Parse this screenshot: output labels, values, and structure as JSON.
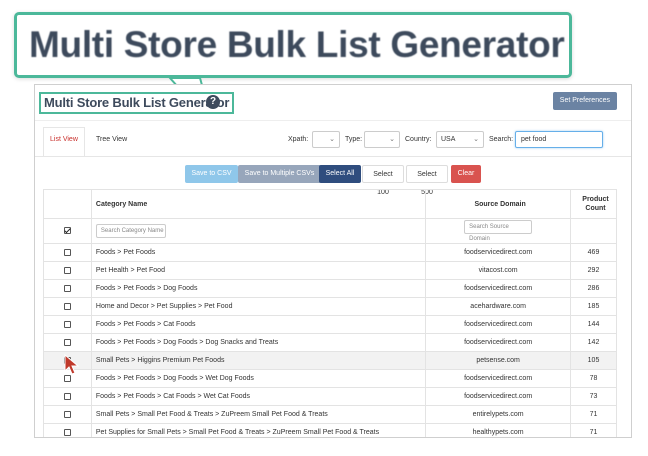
{
  "callout": {
    "title": "Multi Store Bulk List Generator"
  },
  "header": {
    "title": "Multi Store Bulk List Generator",
    "help_glyph": "?",
    "preferences_label": "Set Preferences"
  },
  "toolbar": {
    "tabs": [
      {
        "label": "List View",
        "active": true
      },
      {
        "label": "Tree View",
        "active": false
      }
    ],
    "xpath_label": "Xpath:",
    "xpath_value": "",
    "type_label": "Type:",
    "type_value": "",
    "country_label": "Country:",
    "country_value": "USA",
    "search_label": "Search:",
    "search_value": "pet food"
  },
  "actions": {
    "save_csv": "Save to CSV",
    "save_multi": "Save to Multiple CSVs",
    "select_all": "Select All",
    "select_100": "Select 100",
    "select_500": "Select 500",
    "clear": "Clear"
  },
  "table": {
    "columns": {
      "category": "Category Name",
      "domain": "Source Domain",
      "count_line1": "Product",
      "count_line2": "Count"
    },
    "filters": {
      "category_placeholder": "Search Category Name",
      "domain_placeholder": "Search Source Domain"
    },
    "rows": [
      {
        "category": "Foods > Pet Foods",
        "domain": "foodservicedirect.com",
        "count": "469"
      },
      {
        "category": "Pet Health > Pet Food",
        "domain": "vitacost.com",
        "count": "292"
      },
      {
        "category": "Foods > Pet Foods > Dog Foods",
        "domain": "foodservicedirect.com",
        "count": "286"
      },
      {
        "category": "Home and Decor > Pet Supplies > Pet Food",
        "domain": "acehardware.com",
        "count": "185"
      },
      {
        "category": "Foods > Pet Foods > Cat Foods",
        "domain": "foodservicedirect.com",
        "count": "144"
      },
      {
        "category": "Foods > Pet Foods > Dog Foods > Dog Snacks and Treats",
        "domain": "foodservicedirect.com",
        "count": "142"
      },
      {
        "category": "Small Pets > Higgins Premium Pet Foods",
        "domain": "petsense.com",
        "count": "105"
      },
      {
        "category": "Foods > Pet Foods > Dog Foods > Wet Dog Foods",
        "domain": "foodservicedirect.com",
        "count": "78"
      },
      {
        "category": "Foods > Pet Foods > Cat Foods > Wet Cat Foods",
        "domain": "foodservicedirect.com",
        "count": "73"
      },
      {
        "category": "Small Pets > Small Pet Food & Treats > ZuPreem Small Pet Food & Treats",
        "domain": "entirelypets.com",
        "count": "71"
      },
      {
        "category": "Pet Supplies for Small Pets > Small Pet Food & Treats > ZuPreem Small Pet Food & Treats",
        "domain": "healthypets.com",
        "count": "71"
      }
    ]
  },
  "colors": {
    "accent_border": "#4cb89a",
    "title_text": "#3d4a5c",
    "select_all_bg": "#2f4d7e",
    "clear_bg": "#d9534f",
    "cursor": "#c0392b"
  }
}
